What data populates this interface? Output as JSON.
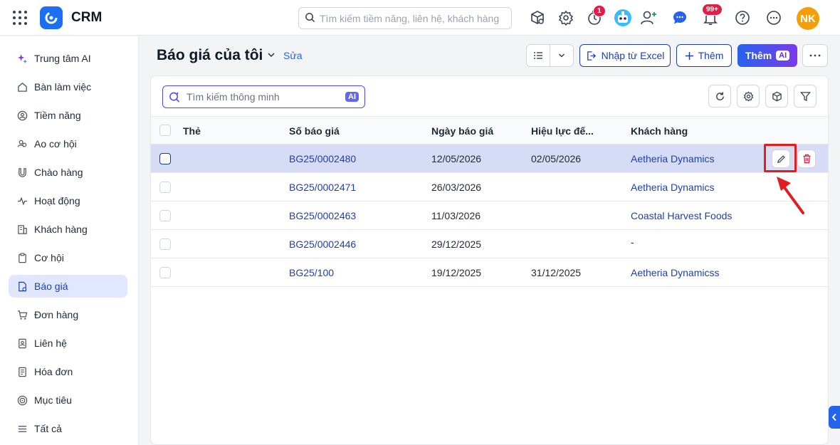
{
  "app": {
    "name": "CRM",
    "brand_color": "#1d6ff2"
  },
  "topbar": {
    "search_placeholder": "Tìm kiếm tiềm năng, liên hệ, khách hàng",
    "timer_badge": "1",
    "notification_badge": "99+",
    "user_initials": "NK",
    "icons": [
      "cube-search-icon",
      "gear-icon",
      "timer-icon",
      "robot-avatar-icon",
      "add-user-icon",
      "chat-icon",
      "bell-icon",
      "help-icon",
      "more-icon"
    ]
  },
  "sidebar": {
    "items": [
      {
        "label": "Trung tâm AI",
        "icon": "sparkle-icon"
      },
      {
        "label": "Bàn làm việc",
        "icon": "home-icon"
      },
      {
        "label": "Tiềm năng",
        "icon": "target-person-icon"
      },
      {
        "label": "Ao cơ hội",
        "icon": "people-icon"
      },
      {
        "label": "Chào hàng",
        "icon": "magnet-icon"
      },
      {
        "label": "Hoạt động",
        "icon": "activity-icon"
      },
      {
        "label": "Khách hàng",
        "icon": "building-icon"
      },
      {
        "label": "Cơ hội",
        "icon": "clipboard-icon"
      },
      {
        "label": "Báo giá",
        "icon": "quote-doc-icon",
        "active": true
      },
      {
        "label": "Đơn hàng",
        "icon": "cart-icon"
      },
      {
        "label": "Liên hệ",
        "icon": "contact-book-icon"
      },
      {
        "label": "Hóa đơn",
        "icon": "invoice-icon"
      },
      {
        "label": "Mục tiêu",
        "icon": "goal-icon"
      },
      {
        "label": "Tất cả",
        "icon": "menu-icon"
      }
    ]
  },
  "header": {
    "title": "Báo giá của tôi",
    "edit_label": "Sửa",
    "import_label": "Nhập từ Excel",
    "add_label": "Thêm",
    "add_ai_label": "Thêm",
    "ai_tag": "AI"
  },
  "toolbar": {
    "smart_search_placeholder": "Tìm kiếm thông minh",
    "ai_tag": "AI"
  },
  "table": {
    "columns": [
      "Thẻ",
      "Số báo giá",
      "Ngày báo giá",
      "Hiệu lực đế...",
      "Khách hàng"
    ],
    "rows": [
      {
        "tag": "",
        "number": "BG25/0002480",
        "date": "12/05/2026",
        "valid_until": "02/05/2026",
        "customer": "Aetheria Dynamics",
        "selected": true
      },
      {
        "tag": "",
        "number": "BG25/0002471",
        "date": "26/03/2026",
        "valid_until": "",
        "customer": "Aetheria Dynamics"
      },
      {
        "tag": "",
        "number": "BG25/0002463",
        "date": "11/03/2026",
        "valid_until": "",
        "customer": "Coastal Harvest Foods"
      },
      {
        "tag": "",
        "number": "BG25/0002446",
        "date": "29/12/2025",
        "valid_until": "",
        "customer": "-"
      },
      {
        "tag": "",
        "number": "BG25/100",
        "date": "19/12/2025",
        "valid_until": "31/12/2025",
        "customer": "Aetheria Dynamicss"
      }
    ]
  }
}
